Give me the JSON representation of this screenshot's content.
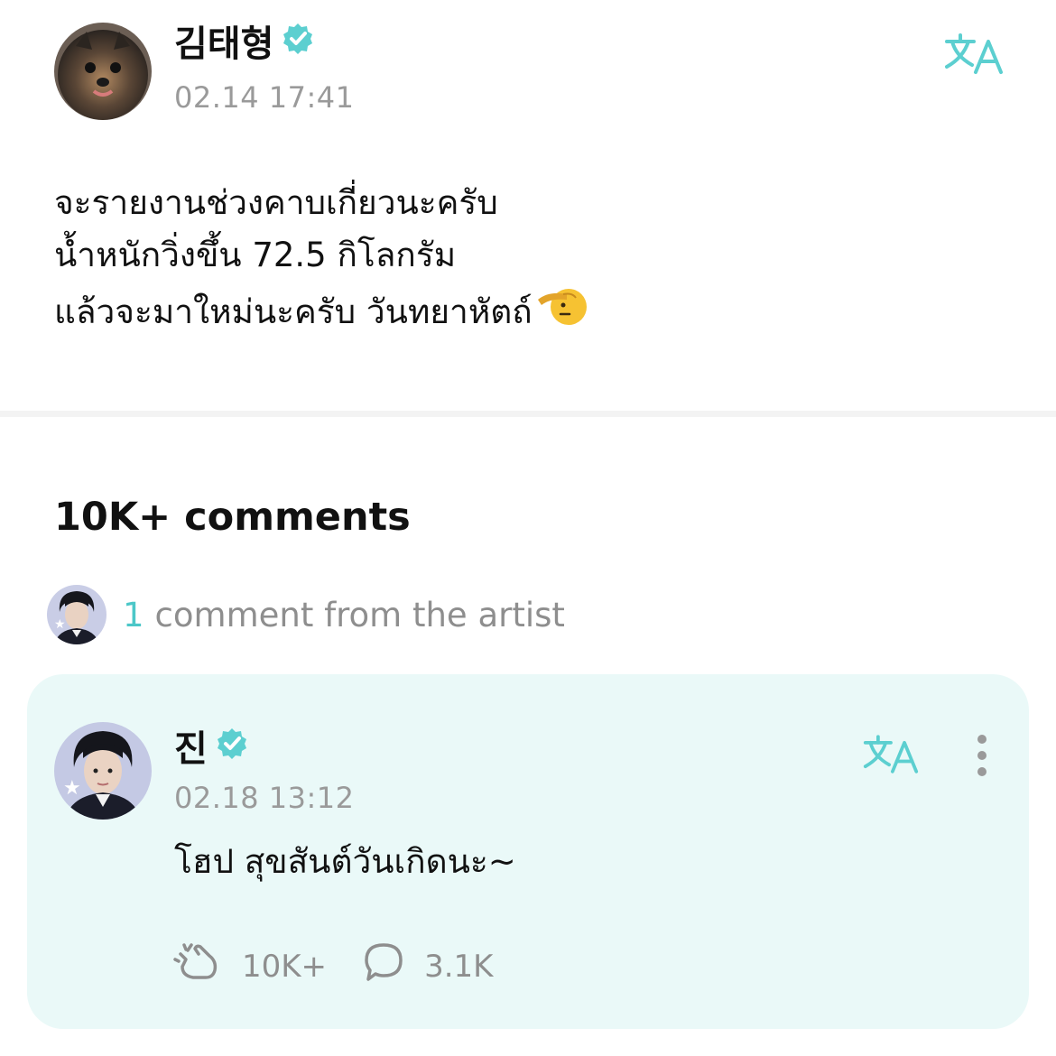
{
  "post": {
    "author": "김태형",
    "timestamp": "02.14 17:41",
    "lines": [
      "จะรายงานช่วงคาบเกี่ยวนะครับ",
      "น้ำหนักวิ่งขึ้น 72.5 กิโลกรัม",
      "แล้วจะมาใหม่นะครับ วันทยาหัตถ์"
    ],
    "emoji": "saluting-face"
  },
  "comments": {
    "heading": "10K+ comments",
    "artist_count": "1",
    "artist_label": "comment from the artist"
  },
  "artist_comment": {
    "author": "진",
    "timestamp": "02.18 13:12",
    "text": "โฮป สุขสันต์วันเกิดนะ~",
    "likes": "10K+",
    "replies": "3.1K"
  },
  "colors": {
    "accent": "#4cc7c8",
    "card_bg": "#eaf9f8",
    "muted": "#9a9a9a"
  },
  "icons": {
    "verified": "verified-badge-icon",
    "translate": "translate-icon",
    "like": "cheer-hand-icon",
    "reply": "speech-bubble-icon",
    "more": "more-vertical-icon"
  }
}
